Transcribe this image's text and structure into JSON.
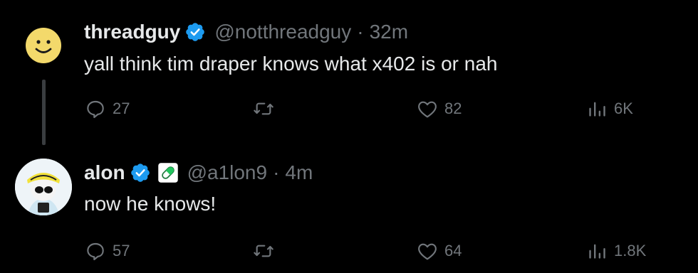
{
  "tweets": [
    {
      "name": "threadguy",
      "handle": "@notthreadguy",
      "separator": "·",
      "time": "32m",
      "text": "yall think tim draper knows what x402 is or nah",
      "replies": "27",
      "retweets": "",
      "likes": "82",
      "views": "6K"
    },
    {
      "name": "alon",
      "handle": "@a1lon9",
      "separator": "·",
      "time": "4m",
      "text": "now he knows!",
      "replies": "57",
      "retweets": "",
      "likes": "64",
      "views": "1.8K"
    }
  ],
  "colors": {
    "background": "#000000",
    "text": "#e7e9ea",
    "muted": "#71767b",
    "verified": "#1d9bf0",
    "thread_line": "#3a3d40"
  }
}
